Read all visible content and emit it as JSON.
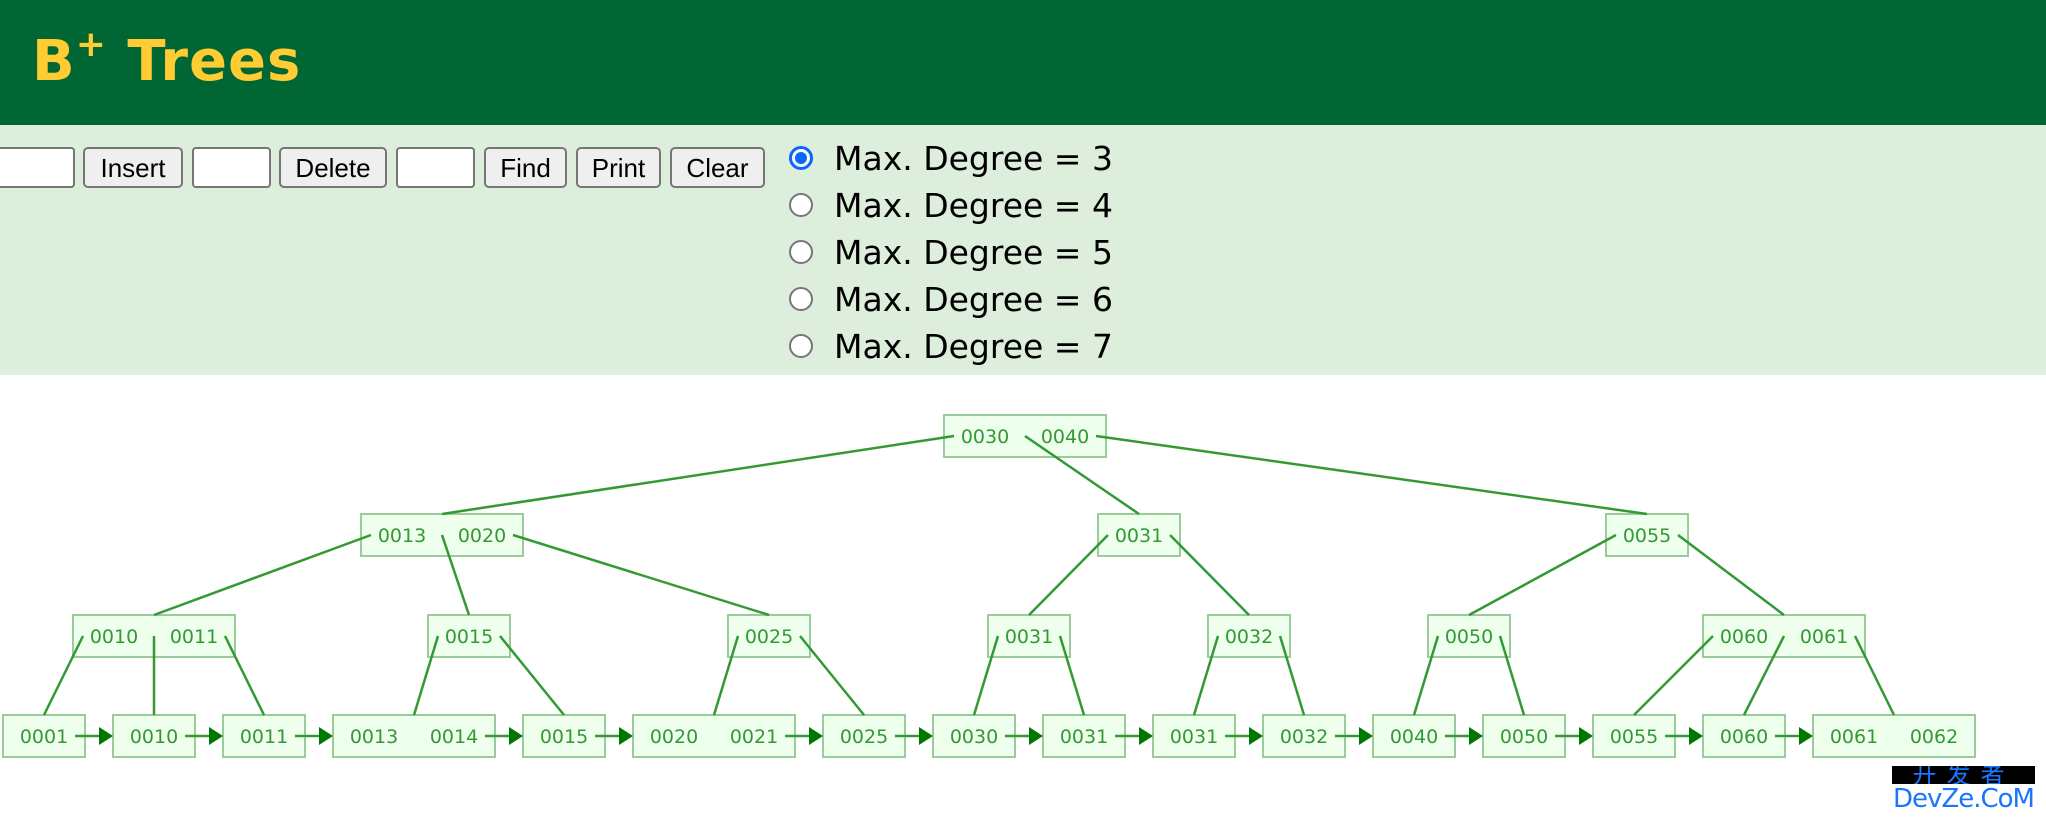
{
  "header": {
    "title_main": "B",
    "title_sup": "+",
    "title_rest": " Trees"
  },
  "controls": {
    "insert_input": {
      "value": "",
      "placeholder": ""
    },
    "insert_label": "Insert",
    "delete_input": {
      "value": "",
      "placeholder": ""
    },
    "delete_label": "Delete",
    "find_input": {
      "value": "",
      "placeholder": ""
    },
    "find_label": "Find",
    "print_label": "Print",
    "clear_label": "Clear",
    "degree_options": [
      {
        "label": "Max. Degree = 3",
        "value": 3,
        "checked": true
      },
      {
        "label": "Max. Degree = 4",
        "value": 4,
        "checked": false
      },
      {
        "label": "Max. Degree = 5",
        "value": 5,
        "checked": false
      },
      {
        "label": "Max. Degree = 6",
        "value": 6,
        "checked": false
      },
      {
        "label": "Max. Degree = 7",
        "value": 7,
        "checked": false
      }
    ]
  },
  "tree": {
    "colors": {
      "node_fill": "#eeffee",
      "node_border": "#99cc99",
      "key_text": "#339933",
      "edge": "#339933",
      "arrowhead": "#007700"
    },
    "levels": [
      [
        {
          "keys": [
            "0030",
            "0040"
          ]
        }
      ],
      [
        {
          "keys": [
            "0013",
            "0020"
          ]
        },
        {
          "keys": [
            "0031"
          ]
        },
        {
          "keys": [
            "0055"
          ]
        }
      ],
      [
        {
          "keys": [
            "0010",
            "0011"
          ],
          "parent": 0
        },
        {
          "keys": [
            "0015"
          ],
          "parent": 0
        },
        {
          "keys": [
            "0025"
          ],
          "parent": 0
        },
        {
          "keys": [
            "0031"
          ],
          "parent": 1
        },
        {
          "keys": [
            "0032"
          ],
          "parent": 1
        },
        {
          "keys": [
            "0050"
          ],
          "parent": 2
        },
        {
          "keys": [
            "0060",
            "0061"
          ],
          "parent": 2
        }
      ],
      [
        {
          "keys": [
            "0001"
          ],
          "parent": 0
        },
        {
          "keys": [
            "0010"
          ],
          "parent": 0
        },
        {
          "keys": [
            "0011"
          ],
          "parent": 0
        },
        {
          "keys": [
            "0013",
            "0014"
          ],
          "parent": 1
        },
        {
          "keys": [
            "0015"
          ],
          "parent": 1
        },
        {
          "keys": [
            "0020",
            "0021"
          ],
          "parent": 2
        },
        {
          "keys": [
            "0025"
          ],
          "parent": 2
        },
        {
          "keys": [
            "0030"
          ],
          "parent": 3
        },
        {
          "keys": [
            "0031"
          ],
          "parent": 3
        },
        {
          "keys": [
            "0031"
          ],
          "parent": 4
        },
        {
          "keys": [
            "0032"
          ],
          "parent": 4
        },
        {
          "keys": [
            "0040"
          ],
          "parent": 5
        },
        {
          "keys": [
            "0050"
          ],
          "parent": 5
        },
        {
          "keys": [
            "0055"
          ],
          "parent": 6
        },
        {
          "keys": [
            "0060"
          ],
          "parent": 6
        },
        {
          "keys": [
            "0061",
            "0062"
          ],
          "parent": 6
        }
      ]
    ],
    "level_parents": [
      [],
      [
        0,
        0,
        0
      ],
      [],
      []
    ]
  },
  "watermark": {
    "top": "开发者",
    "bottom": "DevZe.CoM",
    "color": "#1a75ff"
  }
}
